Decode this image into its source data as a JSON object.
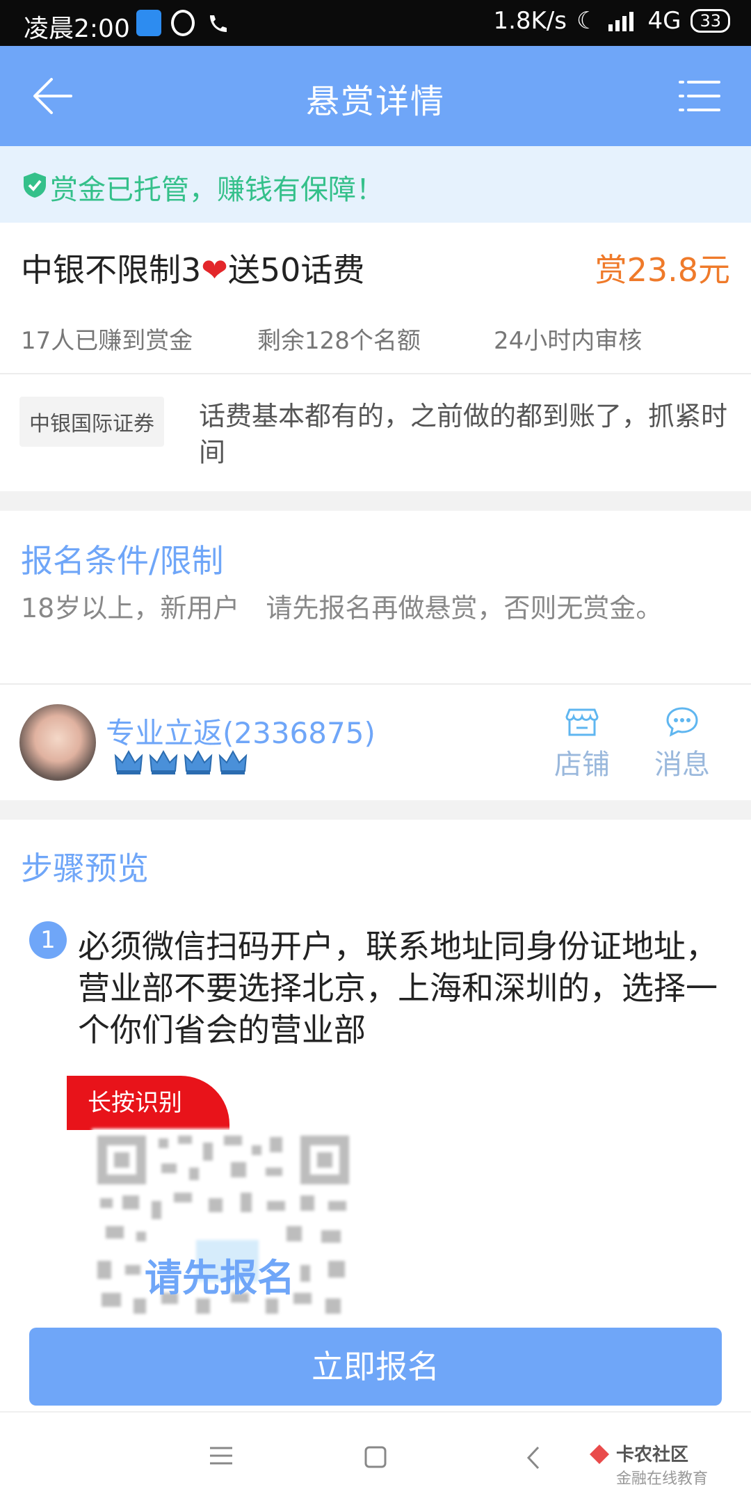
{
  "status_bar": {
    "time": "凌晨2:00",
    "net_speed": "1.8K/s",
    "network": "4G",
    "battery": "33"
  },
  "header": {
    "title": "悬赏详情"
  },
  "safety_notice": "赏金已托管，赚钱有保障！",
  "task": {
    "title_part1": "中银不限制3",
    "title_heart": "❤",
    "title_part2": "送50话费",
    "reward": "赏23.8元",
    "stats": [
      "17人已赚到赏金",
      "剩余128个名额",
      "24小时内审核"
    ],
    "tag": "中银国际证券",
    "description": "话费基本都有的，之前做的都到账了，抓紧时间"
  },
  "conditions": {
    "title": "报名条件/限制",
    "text": "18岁以上，新用户　请先报名再做悬赏，否则无赏金。"
  },
  "publisher": {
    "name": "专业立返(2336875)",
    "crown_count": 4,
    "shop_label": "店铺",
    "message_label": "消息"
  },
  "steps": {
    "title": "步骤预览",
    "items": [
      {
        "number": "1",
        "text": "必须微信扫码开户，联系地址同身份证地址，营业部不要选择北京，上海和深圳的，选择一个你们省会的营业部"
      }
    ],
    "long_press_label": "长按识别",
    "qr_overlay": "请先报名"
  },
  "signup_button": "立即报名",
  "watermark": {
    "title": "卡农社区",
    "subtitle": "金融在线教育"
  },
  "colors": {
    "primary": "#6fa6f8",
    "reward": "#ef7a2a",
    "safe": "#34c08a",
    "badge_red": "#e8131a"
  }
}
